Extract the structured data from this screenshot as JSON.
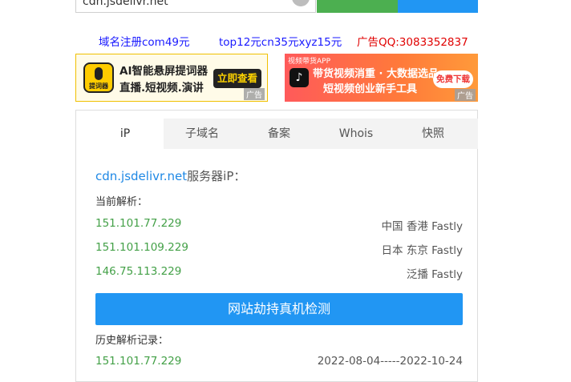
{
  "search": {
    "value": "cdn.jsdelivr.net",
    "clear_icon": "x-circle-icon"
  },
  "promos": [
    {
      "text": "域名注册com49元",
      "color": "#1a1aff"
    },
    {
      "text": "top12元cn35元xyz15元",
      "color": "#1a1aff"
    },
    {
      "text": "广告QQ:3083352837",
      "color": "#e00000"
    }
  ],
  "ads": {
    "left": {
      "app_icon_label": "提词器",
      "title": "AI智能悬屏提词器",
      "subtitle": "直播.短视频.演讲",
      "cta": "立即查看",
      "mark": "广告"
    },
    "right": {
      "app_name": "视频带货APP",
      "title": "带货视频消重 · 大数据选品",
      "subtitle": "短视频创业新手工具",
      "cta": "免费下载",
      "mark": "广告"
    }
  },
  "tabs": [
    {
      "label": "iP",
      "active": true
    },
    {
      "label": "子域名"
    },
    {
      "label": "备案"
    },
    {
      "label": "Whois"
    },
    {
      "label": "快照"
    }
  ],
  "result": {
    "host": "cdn.jsdelivr.net",
    "host_suffix": "服务器iP：",
    "current_label": "当前解析：",
    "current": [
      {
        "ip": "151.101.77.229",
        "location": "中国 香港 Fastly"
      },
      {
        "ip": "151.101.109.229",
        "location": "日本 东京 Fastly"
      },
      {
        "ip": "146.75.113.229",
        "location": "泛播 Fastly"
      }
    ],
    "check_button": "网站劫持真机检测",
    "history_label": "历史解析记录：",
    "history": [
      {
        "ip": "151.101.77.229",
        "range": "2022-08-04-----2022-10-24"
      }
    ]
  },
  "colors": {
    "ip_green": "#43a047",
    "link_blue": "#1e88e5",
    "button_blue": "#2196f3",
    "btn_green": "#4caf50"
  }
}
